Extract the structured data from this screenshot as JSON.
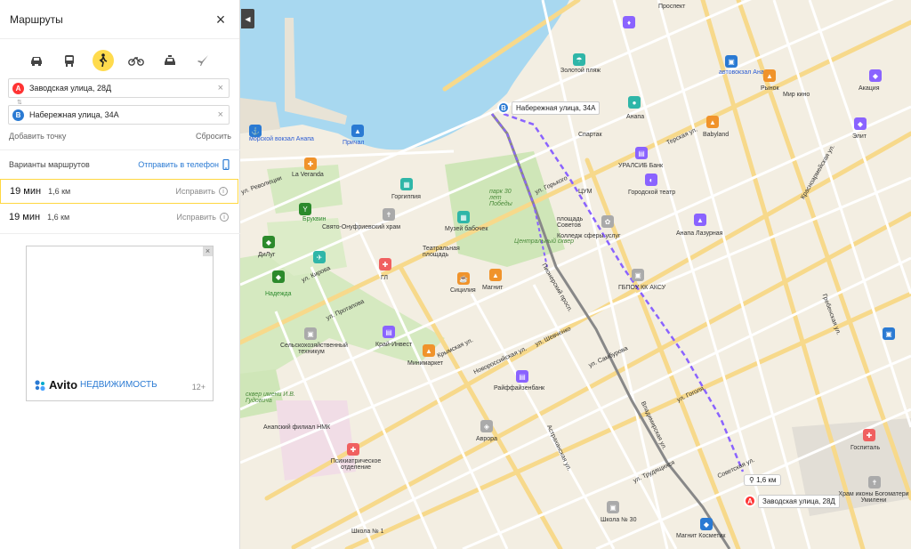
{
  "panel": {
    "title": "Маршруты",
    "close_icon": "close-icon",
    "modes": [
      "car-icon",
      "bus-icon",
      "walk-icon",
      "bike-icon",
      "taxi-icon",
      "plane-icon"
    ],
    "active_mode": "walk-icon",
    "waypoint_a": {
      "marker": "A",
      "value": "Заводская улица, 28Д"
    },
    "waypoint_b": {
      "marker": "B",
      "value": "Набережная улица, 34А"
    },
    "add_point": "Добавить точку",
    "reset": "Сбросить",
    "variants_label": "Варианты маршрутов",
    "send_to_phone": "Отправить в телефон",
    "routes": [
      {
        "time": "19 мин",
        "distance": "1,6 км",
        "fix": "Исправить"
      },
      {
        "time": "19 мин",
        "distance": "1,6 км",
        "fix": "Исправить"
      }
    ]
  },
  "ad": {
    "brand": "Avito",
    "sub": "НЕДВИЖИМОСТЬ",
    "age": "12+"
  },
  "map": {
    "colors": {
      "accent": "#ffdb4d",
      "route": "#8a63ff",
      "marker_a": "#f33",
      "marker_b": "#2a7ad3",
      "park": "#cfe6b8",
      "sea": "#a8d8f0"
    },
    "pin_b_label": "Набережная улица, 34А",
    "pin_a_label": "Заводская улица, 28Д",
    "distance_chip": "1,6 км",
    "labels": {
      "prospekt": "Проспект",
      "zolotoy": "Золотой пляж",
      "avtovokzal": "автовокзал Анапа",
      "rynok": "Рынок",
      "mirkino": "Мир кино",
      "akaciya": "Акация",
      "anapa": "Анапа",
      "sparta": "Спартак",
      "morvokzal": "морской вокзал Анапа",
      "prichal": "Причал",
      "veranda": "La Veranda",
      "gorgippia": "Горгиппия",
      "park30": "парк 30 лет Победы",
      "muzeybab": "Музей бабочек",
      "ploshchad": "площадь Советов",
      "uralsib": "УРАЛСИБ Банк",
      "gortheatr": "Городской театр",
      "tsum": "ЦУМ",
      "babyland": "Babyland",
      "elit": "Элит",
      "brukvin": "Бруквин",
      "svyato": "Свято-Онуфриевский храм",
      "teatr": "Театральная площадь",
      "tsentr": "Центральный сквер",
      "anapalaz": "Анапа Лазурная",
      "gbpou": "ГБПОУ КК АКСУ",
      "koll": "Колледж сферы услуг",
      "dilug": "ДиЛуг",
      "gl": "ГЛ",
      "sitsiliya": "Сицилия",
      "magnit": "Магнит",
      "nadezhda": "Надежда",
      "selskoh": "Сельскохозяйственный техникум",
      "kraiinvest": "Край-Инвест",
      "minimarket": "Минимаркет",
      "raiff": "Райффайзенбанк",
      "skver": "сквер имени И.В. Гудовича",
      "nmk": "Анапский филиал НМК",
      "avrora": "Аврора",
      "psikh": "Психиатрическое отделение",
      "shkola1": "Школа № 1",
      "shkola30": "Школа № 30",
      "magnitcosm": "Магнит Косметик",
      "gospital": "Госпиталь",
      "hram": "Храм иконы Богоматери Умилени",
      "krymskaya": "Крымская ул.",
      "shevchenko": "ул. Шевченко",
      "samburova": "ул. Самбурова",
      "novoross": "Новороссийская ул.",
      "astrakh": "Астраханская ул.",
      "vladimir": "Владимирская ул.",
      "pionersk": "Пионерский просп.",
      "protapova": "ул. Протапова",
      "kirova": "ул. Кирова",
      "revolyutsii": "ул. Революции",
      "terskaya": "Терская ул.",
      "gorkogo": "ул. Горького",
      "krasnoarm": "Красноармейская ул.",
      "grebenskaya": "Гребенская ул.",
      "gogolya": "ул. Гоголя",
      "trudyashchihsya": "ул. Трудящихся",
      "sovetskaya": "Советская ул."
    }
  }
}
